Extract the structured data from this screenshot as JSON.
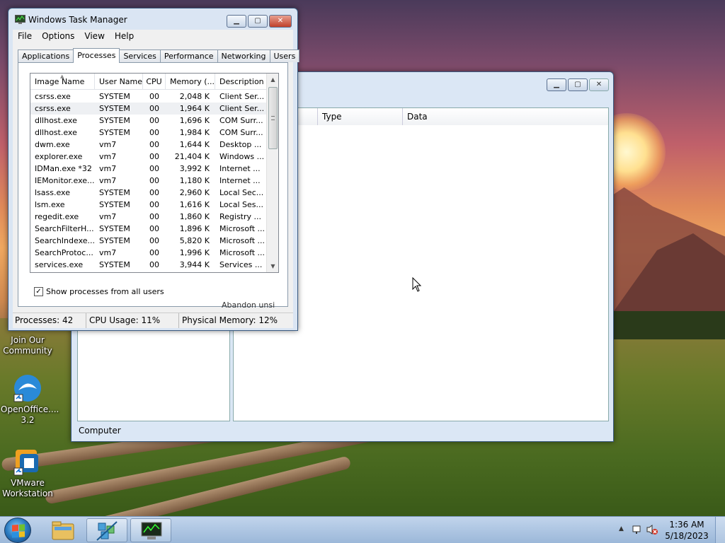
{
  "desktop": {
    "icons": [
      {
        "label": "Join Our Community"
      },
      {
        "label": "OpenOffice.... 3.2"
      },
      {
        "label": "VMware Workstation"
      }
    ]
  },
  "bg_window": {
    "columns": [
      "Type",
      "Data"
    ],
    "status": "Computer"
  },
  "taskmgr": {
    "title": "Windows Task Manager",
    "menu": [
      "File",
      "Options",
      "View",
      "Help"
    ],
    "tabs": [
      "Applications",
      "Processes",
      "Services",
      "Performance",
      "Networking",
      "Users"
    ],
    "active_tab": "Processes",
    "columns": [
      "Image Name",
      "User Name",
      "CPU",
      "Memory (...",
      "Description"
    ],
    "rows": [
      {
        "image": "csrss.exe",
        "user": "SYSTEM",
        "cpu": "00",
        "mem": "2,048 K",
        "desc": "Client Ser..."
      },
      {
        "image": "csrss.exe",
        "user": "SYSTEM",
        "cpu": "00",
        "mem": "1,964 K",
        "desc": "Client Ser..."
      },
      {
        "image": "dllhost.exe",
        "user": "SYSTEM",
        "cpu": "00",
        "mem": "1,696 K",
        "desc": "COM Surr..."
      },
      {
        "image": "dllhost.exe",
        "user": "SYSTEM",
        "cpu": "00",
        "mem": "1,984 K",
        "desc": "COM Surr..."
      },
      {
        "image": "dwm.exe",
        "user": "vm7",
        "cpu": "00",
        "mem": "1,644 K",
        "desc": "Desktop ..."
      },
      {
        "image": "explorer.exe",
        "user": "vm7",
        "cpu": "00",
        "mem": "21,404 K",
        "desc": "Windows ..."
      },
      {
        "image": "IDMan.exe *32",
        "user": "vm7",
        "cpu": "00",
        "mem": "3,992 K",
        "desc": "Internet ..."
      },
      {
        "image": "IEMonitor.exe...",
        "user": "vm7",
        "cpu": "00",
        "mem": "1,180 K",
        "desc": "Internet ..."
      },
      {
        "image": "lsass.exe",
        "user": "SYSTEM",
        "cpu": "00",
        "mem": "2,960 K",
        "desc": "Local Sec..."
      },
      {
        "image": "lsm.exe",
        "user": "SYSTEM",
        "cpu": "00",
        "mem": "1,616 K",
        "desc": "Local Ses..."
      },
      {
        "image": "regedit.exe",
        "user": "vm7",
        "cpu": "00",
        "mem": "1,860 K",
        "desc": "Registry ..."
      },
      {
        "image": "SearchFilterH...",
        "user": "SYSTEM",
        "cpu": "00",
        "mem": "1,896 K",
        "desc": "Microsoft ..."
      },
      {
        "image": "SearchIndexe...",
        "user": "SYSTEM",
        "cpu": "00",
        "mem": "5,820 K",
        "desc": "Microsoft ..."
      },
      {
        "image": "SearchProtoc...",
        "user": "vm7",
        "cpu": "00",
        "mem": "1,996 K",
        "desc": "Microsoft ..."
      },
      {
        "image": "services.exe",
        "user": "SYSTEM",
        "cpu": "00",
        "mem": "3,944 K",
        "desc": "Services ..."
      }
    ],
    "show_all_label": "Show processes from all users",
    "show_all_checked": true,
    "ghost_text": "Abandon unsi",
    "status": {
      "processes": "Processes: 42",
      "cpu": "CPU Usage: 11%",
      "memory": "Physical Memory: 12%"
    }
  },
  "taskbar": {
    "time": "1:36 AM",
    "date": "5/18/2023",
    "items": [
      "explorer-icon",
      "network-install-icon",
      "task-manager-icon"
    ]
  }
}
